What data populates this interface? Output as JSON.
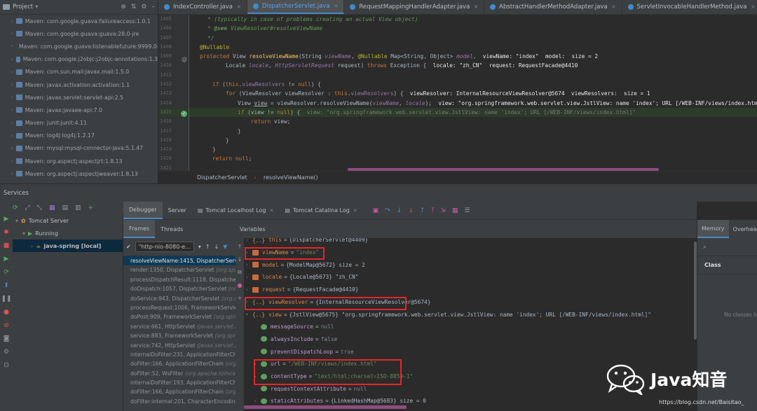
{
  "project": {
    "title": "Project",
    "items": [
      "Maven: com.google.guava:failureaccess:1.0.1",
      "Maven: com.google.guava:guava:28.0-jre",
      "Maven: com.google.guava:listenablefuture:9999.0-e",
      "Maven: com.google.j2objc:j2objc-annotations:1.3",
      "Maven: com.sun.mail:javax.mail:1.5.0",
      "Maven: javax.activation:activation:1.1",
      "Maven: javax.servlet:servlet-api:2.5",
      "Maven: javax:javaee-api:7.0",
      "Maven: junit:junit:4.11",
      "Maven: log4j:log4j:1.2.17",
      "Maven: mysql:mysql-connector-java:5.1.47",
      "Maven: org.aspectj:aspectjrt:1.8.13",
      "Maven: org.aspectj:aspectjweaver:1.8.13"
    ]
  },
  "editor": {
    "tabs": [
      "IndexController.java",
      "DispatcherServlet.java",
      "RequestMappingHandlerAdapter.java",
      "AbstractHandlerMethodAdapter.java",
      "ServletInvocableHandlerMethod.java"
    ],
    "active_tab": 1,
    "line_numbers": [
      "1405",
      "1406",
      "1407",
      "1408",
      "1409",
      "1410",
      "1411",
      "1412",
      "1413",
      "1414",
      "1415",
      "1416",
      "1417",
      "1418",
      "1419",
      "1420",
      "1421"
    ],
    "highlight_line": 10,
    "breadcrumb": [
      "DispatcherServlet",
      "resolveViewName()"
    ]
  },
  "services": {
    "title": "Services",
    "tree": [
      {
        "label": "Tomcat Server",
        "level": 0
      },
      {
        "label": "Running",
        "level": 1
      },
      {
        "label": "java-spring [local]",
        "level": 2
      }
    ]
  },
  "debugger": {
    "tabs": [
      "Debugger",
      "Server",
      "Tomcat Localhost Log",
      "Tomcat Catalina Log"
    ],
    "frames_tab": "Frames",
    "threads_tab": "Threads",
    "thread": "\"http-nio-8080-e...",
    "variables_label": "Variables",
    "frames": [
      {
        "m": "resolveViewName:1415, DispatcherServlet",
        "c": ""
      },
      {
        "m": "render:1350, DispatcherServlet",
        "c": "(org.spr"
      },
      {
        "m": "processDispatchResult:1118, Dispatcher",
        "c": ""
      },
      {
        "m": "doDispatch:1057, DispatcherServlet",
        "c": "(org."
      },
      {
        "m": "doService:943, DispatcherServlet",
        "c": "(org.sp"
      },
      {
        "m": "processRequest:1006, FrameworkServlet",
        "c": ""
      },
      {
        "m": "doPost:909, FrameworkServlet",
        "c": "(org.spri"
      },
      {
        "m": "service:661, HttpServlet",
        "c": "(javax.servlet.h"
      },
      {
        "m": "service:883, FrameworkServlet",
        "c": "(org.spri"
      },
      {
        "m": "service:742, HttpServlet",
        "c": "(javax.servlet.ht"
      },
      {
        "m": "internalDoFilter:231, ApplicationFilterCha",
        "c": ""
      },
      {
        "m": "doFilter:166, ApplicationFilterChain",
        "c": "(org."
      },
      {
        "m": "doFilter:52, WsFilter",
        "c": "(org.apache.tomca"
      },
      {
        "m": "internalDoFilter:193, ApplicationFilterCha",
        "c": ""
      },
      {
        "m": "doFilter:166, ApplicationFilterChain",
        "c": "(org."
      },
      {
        "m": "doFilter:internal:201, CharacterEncoding",
        "c": ""
      }
    ],
    "variables": [
      {
        "name": "this",
        "value": "{DispatcherServlet@4409}",
        "kind": "brace",
        "indent": 0,
        "cut": true
      },
      {
        "name": "viewName",
        "value": "\"index\"",
        "kind": "obj",
        "indent": 0,
        "str": true
      },
      {
        "name": "model",
        "value": "{ModelMap@5672}  size = 2",
        "kind": "obj",
        "indent": 0
      },
      {
        "name": "locale",
        "value": "{Locale@5673} \"zh_CN\"",
        "kind": "obj",
        "indent": 0
      },
      {
        "name": "request",
        "value": "{RequestFacade@4410}",
        "kind": "obj",
        "indent": 0
      },
      {
        "name": "viewResolver",
        "value": "{InternalResourceViewResolver@5674}",
        "kind": "brace",
        "indent": 0
      },
      {
        "name": "view",
        "value": "{JstlView@5675} \"org.springframework.web.servlet.view.JstlView: name 'index'; URL [/WEB-INF/views/index.html]\"",
        "kind": "brace",
        "indent": 0,
        "open": true
      },
      {
        "name": "messageSource",
        "value": "null",
        "kind": "fld",
        "indent": 1
      },
      {
        "name": "alwaysInclude",
        "value": "false",
        "kind": "fld",
        "indent": 1
      },
      {
        "name": "preventDispatchLoop",
        "value": "true",
        "kind": "fld",
        "indent": 1
      },
      {
        "name": "url",
        "value": "\"/WEB-INF/views/index.html\"",
        "kind": "fld",
        "indent": 1,
        "str": true,
        "arrow": true
      },
      {
        "name": "contentType",
        "value": "\"text/html;charset=ISO-8859-1\"",
        "kind": "fld",
        "indent": 1,
        "str": true,
        "arrow": true
      },
      {
        "name": "requestContextAttribute",
        "value": "null",
        "kind": "fld",
        "indent": 1
      },
      {
        "name": "staticAttributes",
        "value": "{LinkedHashMap@5683}  size = 0",
        "kind": "fld",
        "indent": 1,
        "arrow": true
      }
    ]
  },
  "memory": {
    "tabs": [
      "Memory",
      "Overhead"
    ],
    "column": "Class",
    "empty": "No classes lo"
  },
  "watermark": {
    "text": "Java知音",
    "url": "https://blog.csdn.net/Baisitao_"
  }
}
